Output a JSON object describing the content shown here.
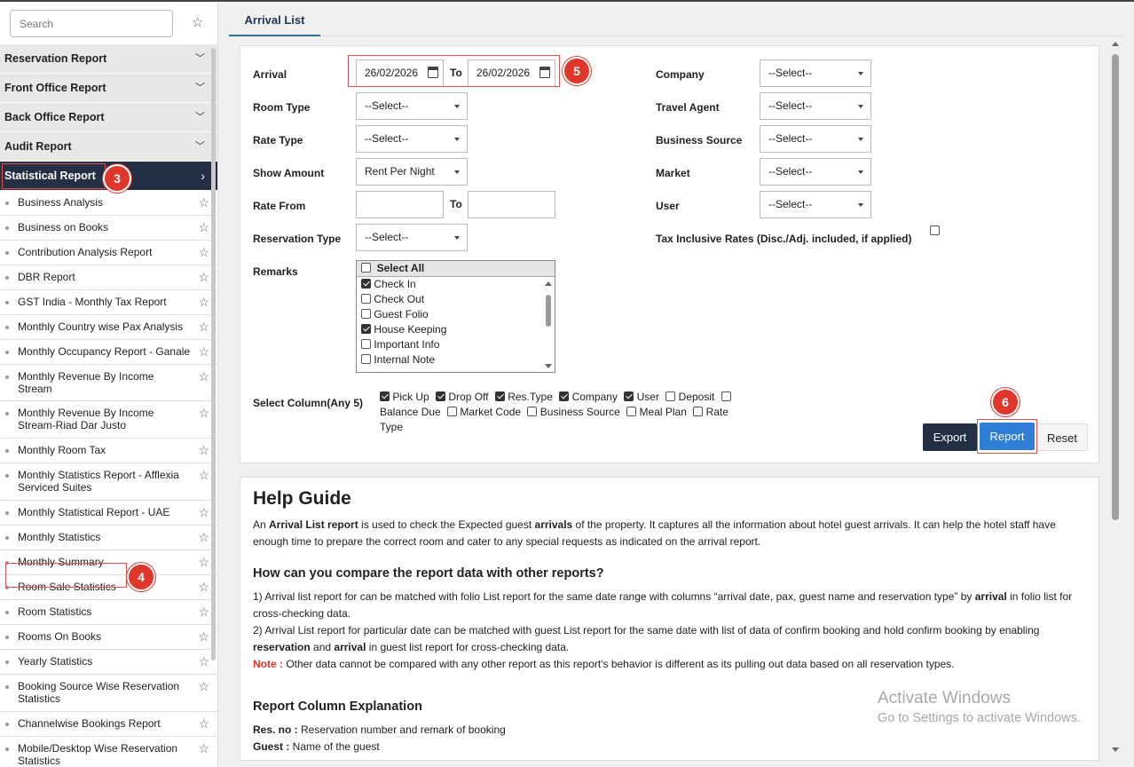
{
  "sidebar": {
    "search_placeholder": "Search",
    "categories": [
      {
        "label": "Reservation Report"
      },
      {
        "label": "Front Office Report"
      },
      {
        "label": "Back Office Report"
      },
      {
        "label": "Audit Report"
      },
      {
        "label": "Statistical Report"
      }
    ],
    "items": [
      {
        "label": "Business Analysis"
      },
      {
        "label": "Business on Books"
      },
      {
        "label": "Contribution Analysis Report"
      },
      {
        "label": "DBR Report"
      },
      {
        "label": "GST India - Monthly Tax Report"
      },
      {
        "label": "Monthly Country wise Pax Analysis"
      },
      {
        "label": "Monthly Occupancy Report - Ganale"
      },
      {
        "label": "Monthly Revenue By Income Stream"
      },
      {
        "label": "Monthly Revenue By Income Stream-Riad Dar Justo"
      },
      {
        "label": "Monthly Room Tax"
      },
      {
        "label": "Monthly Statistics Report - Afflexia Serviced Suites"
      },
      {
        "label": "Monthly Statistical Report - UAE"
      },
      {
        "label": "Monthly Statistics"
      },
      {
        "label": "Monthly Summary"
      },
      {
        "label": "Room Sale Statistics"
      },
      {
        "label": "Room Statistics"
      },
      {
        "label": "Rooms On Books"
      },
      {
        "label": "Yearly Statistics"
      },
      {
        "label": "Booking Source Wise Reservation Statistics"
      },
      {
        "label": "Channelwise Bookings Report"
      },
      {
        "label": "Mobile/Desktop Wise Reservation Statistics"
      }
    ]
  },
  "annotations": {
    "step3": "3",
    "step4": "4",
    "step5": "5",
    "step6": "6"
  },
  "tab": {
    "label": "Arrival List"
  },
  "form": {
    "arrival_label": "Arrival",
    "arrival_from": "26/02/2026",
    "to_label": "To",
    "arrival_to": "26/02/2026",
    "room_type_label": "Room Type",
    "room_type_value": "--Select--",
    "rate_type_label": "Rate Type",
    "rate_type_value": "--Select--",
    "show_amount_label": "Show Amount",
    "show_amount_value": "Rent Per Night",
    "rate_from_label": "Rate From",
    "rate_from_value": "",
    "rate_to_value": "",
    "reservation_type_label": "Reservation Type",
    "reservation_type_value": "--Select--",
    "remarks_label": "Remarks",
    "remarks_select_all": "Select All",
    "remarks_options": [
      {
        "label": "Check In",
        "checked": true
      },
      {
        "label": "Check Out",
        "checked": false
      },
      {
        "label": "Guest Folio",
        "checked": false
      },
      {
        "label": "House Keeping",
        "checked": true
      },
      {
        "label": "Important Info",
        "checked": false
      },
      {
        "label": "Internal Note",
        "checked": false
      }
    ],
    "company_label": "Company",
    "company_value": "--Select--",
    "travel_agent_label": "Travel Agent",
    "travel_agent_value": "--Select--",
    "business_source_label": "Business Source",
    "business_source_value": "--Select--",
    "market_label": "Market",
    "market_value": "--Select--",
    "user_label": "User",
    "user_value": "--Select--",
    "tax_inclusive_label": "Tax Inclusive Rates (Disc./Adj. included, if applied)",
    "select_column_label": "Select Column(Any 5)",
    "columns": [
      {
        "label": "Pick Up",
        "checked": true
      },
      {
        "label": "Drop Off",
        "checked": true
      },
      {
        "label": "Res.Type",
        "checked": true
      },
      {
        "label": "Company",
        "checked": true
      },
      {
        "label": "User",
        "checked": true
      },
      {
        "label": "Deposit",
        "checked": false
      },
      {
        "label": "Balance Due",
        "checked": false
      },
      {
        "label": "Market Code",
        "checked": false
      },
      {
        "label": "Business Source",
        "checked": false
      },
      {
        "label": "Meal Plan",
        "checked": false
      },
      {
        "label": "Rate Type",
        "checked": false
      }
    ]
  },
  "buttons": {
    "export": "Export",
    "report": "Report",
    "reset": "Reset"
  },
  "help": {
    "title": "Help Guide",
    "intro_1": "An ",
    "intro_bold_1": "Arrival List report",
    "intro_2": " is used to check the Expected guest ",
    "intro_bold_2": "arrivals",
    "intro_3": " of the property. It captures all the information about hotel guest arrivals. It can help the hotel staff have enough time to prepare the correct room and cater to any special requests as indicated on the arrival report.",
    "compare_heading": "How can you compare the report data with other reports?",
    "p1_a": "1) Arrival list report for can be matched with folio List report for the same date range with columns “arrival date, pax, guest name and reservation type” by ",
    "p1_b": "arrival",
    "p1_c": " in folio list for cross-checking data.",
    "p2_a": "2) Arrival List report for particular date can be matched with guest List report for the same date with list of data of confirm booking and hold confirm booking by enabling ",
    "p2_b": "reservation",
    "p2_c": " and ",
    "p2_d": "arrival",
    "p2_e": " in guest list report for cross-checking data.",
    "note_label": "Note :",
    "note_text": " Other data cannot be compared with any other report as this report's behavior is different as its pulling out data based on all reservation types.",
    "column_heading": "Report Column Explanation",
    "res_no_label": "Res. no :",
    "res_no_text": " Reservation number and remark of booking",
    "guest_label": "Guest :",
    "guest_text": " Name of the guest"
  },
  "watermark": {
    "title": "Activate Windows",
    "subtitle": "Go to Settings to activate Windows."
  }
}
